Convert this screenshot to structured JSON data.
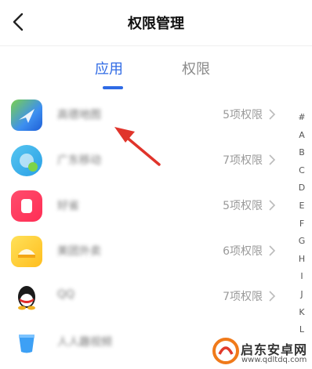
{
  "header": {
    "title": "权限管理"
  },
  "tabs": [
    {
      "label": "应用"
    },
    {
      "label": "权限"
    }
  ],
  "apps": [
    {
      "name": "高德地图",
      "perm": "5项权限",
      "icon": "map-app-icon",
      "color": "#3d8ff0"
    },
    {
      "name": "广东移动",
      "perm": "7项权限",
      "icon": "mobile-app-icon",
      "color": "#2aa0e6"
    },
    {
      "name": "好省",
      "perm": "5项权限",
      "icon": "shopping-app-icon",
      "color": "#ff2e55"
    },
    {
      "name": "美团外卖",
      "perm": "6项权限",
      "icon": "delivery-app-icon",
      "color": "#ffbe1e"
    },
    {
      "name": "QQ",
      "perm": "7项权限",
      "icon": "qq-app-icon",
      "color": "#222222"
    },
    {
      "name": "人人趣视频",
      "perm": "",
      "icon": "video-app-icon",
      "color": "#3da0f5"
    }
  ],
  "index_letters": [
    "#",
    "A",
    "B",
    "C",
    "D",
    "E",
    "F",
    "G",
    "H",
    "I",
    "J",
    "K",
    "L"
  ],
  "watermark": {
    "title": "启东安卓网",
    "url": "www.qdltdq.com"
  },
  "colors": {
    "accent": "#2f6ae5",
    "arrow": "#e0342b"
  }
}
